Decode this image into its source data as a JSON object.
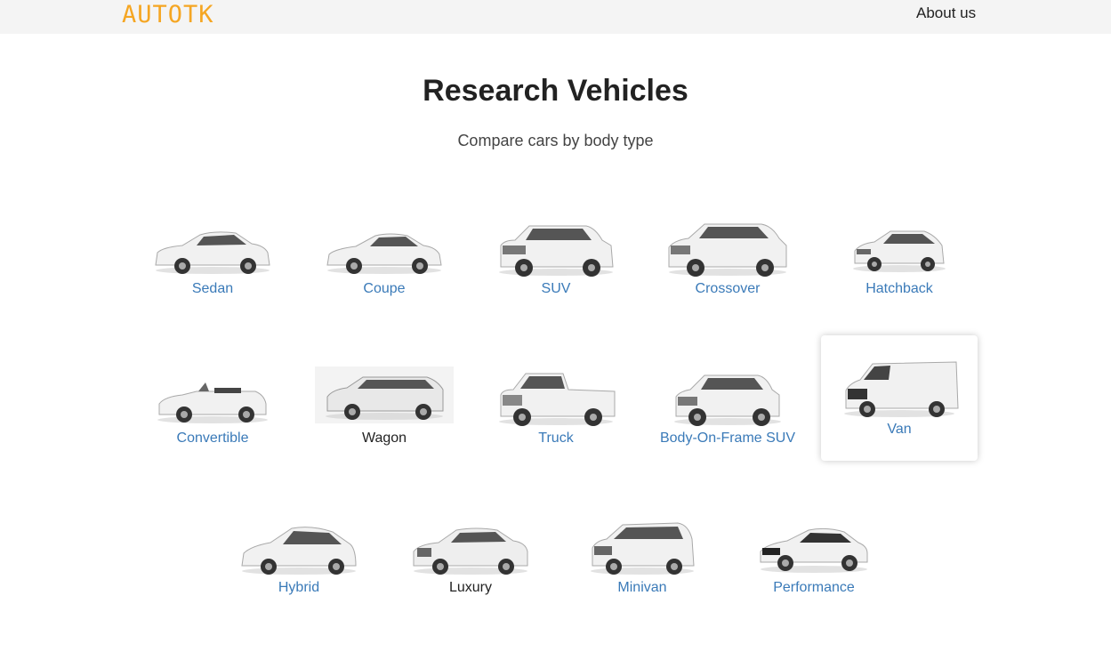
{
  "nav": {
    "brand": "AUTOTK",
    "about_link": "About us"
  },
  "hero": {
    "title": "Research Vehicles",
    "subtitle": "Compare cars by body type"
  },
  "body_types": [
    {
      "label": "Sedan",
      "icon": "sedan-car-icon"
    },
    {
      "label": "Coupe",
      "icon": "coupe-car-icon"
    },
    {
      "label": "SUV",
      "icon": "suv-car-icon"
    },
    {
      "label": "Crossover",
      "icon": "crossover-car-icon"
    },
    {
      "label": "Hatchback",
      "icon": "hatchback-car-icon"
    },
    {
      "label": "Convertible",
      "icon": "convertible-car-icon"
    },
    {
      "label": "Wagon",
      "icon": "wagon-car-icon"
    },
    {
      "label": "Truck",
      "icon": "truck-car-icon"
    },
    {
      "label": "Body-On-Frame SUV",
      "icon": "body-on-frame-suv-car-icon"
    },
    {
      "label": "Van",
      "icon": "van-car-icon",
      "state": "hovered"
    },
    {
      "label": "Hybrid",
      "icon": "hybrid-car-icon"
    },
    {
      "label": "Luxury",
      "icon": "luxury-car-icon"
    },
    {
      "label": "Minivan",
      "icon": "minivan-car-icon"
    },
    {
      "label": "Performance",
      "icon": "performance-car-icon"
    }
  ],
  "colors": {
    "brand": "#f5a623",
    "link": "#3a7ab8",
    "topbar_bg": "#f4f4f4",
    "text": "#222222"
  }
}
